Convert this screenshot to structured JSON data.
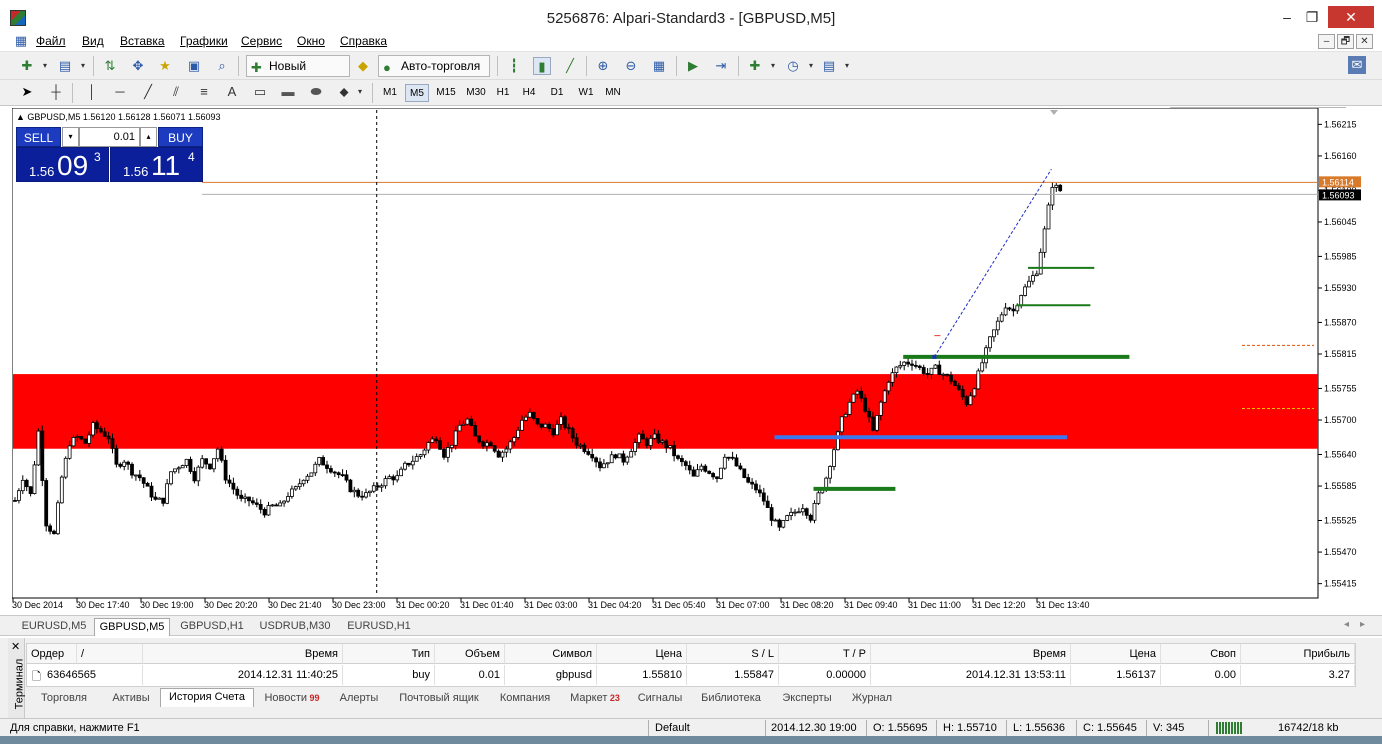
{
  "window": {
    "title": "5256876: Alpari-Standard3 - [GBPUSD,M5]",
    "controls": [
      "–",
      "❐",
      "✕"
    ],
    "mdi_controls": [
      "–",
      "🗗",
      "✕"
    ]
  },
  "menu": [
    "Файл",
    "Вид",
    "Вставка",
    "Графики",
    "Сервис",
    "Окно",
    "Справка"
  ],
  "toolbar": {
    "new_order_label": "Новый Ордер",
    "autotrade_label": "Авто-торговля",
    "text_tool": "A"
  },
  "timeframes": [
    "M1",
    "M5",
    "M15",
    "M30",
    "H1",
    "H4",
    "D1",
    "W1",
    "MN"
  ],
  "active_timeframe": "M5",
  "chart": {
    "info_line": "GBPUSD,M5  1.56120 1.56128 1.56071 1.56093",
    "one_click": {
      "sell_label": "SELL",
      "buy_label": "BUY",
      "lot": "0.01",
      "sell_small": "1.56",
      "sell_big": "09",
      "sell_sup": "3",
      "buy_small": "1.56",
      "buy_big": "11",
      "buy_sup": "4"
    },
    "colors": {
      "zone": "#ff0000",
      "green_level": "#1a7a1a",
      "blue_level": "#3a78ee",
      "ask_line": "#d97a2b",
      "trade_line": "#1f2cc4"
    },
    "ask_marker": "1.56114",
    "bid_marker": "1.56093"
  },
  "chart_data": {
    "type": "candlestick",
    "title": "GBPUSD,M5",
    "ylim": [
      1.5539,
      1.5624
    ],
    "y_ticks": [
      "1.56215",
      "1.56160",
      "1.56100",
      "1.56045",
      "1.55985",
      "1.55930",
      "1.55870",
      "1.55815",
      "1.55755",
      "1.55700",
      "1.55640",
      "1.55585",
      "1.55525",
      "1.55470",
      "1.55415"
    ],
    "x_ticks": [
      "30 Dec 2014",
      "30 Dec 17:40",
      "30 Dec 19:00",
      "30 Dec 20:20",
      "30 Dec 21:40",
      "30 Dec 23:00",
      "31 Dec 00:20",
      "31 Dec 01:40",
      "31 Dec 03:00",
      "31 Dec 04:20",
      "31 Dec 05:40",
      "31 Dec 07:00",
      "31 Dec 08:20",
      "31 Dec 09:40",
      "31 Dec 11:00",
      "31 Dec 12:20",
      "31 Dec 13:40"
    ],
    "close_path": [
      [
        0,
        1.5556
      ],
      [
        2,
        1.556
      ],
      [
        4,
        1.5557
      ],
      [
        6,
        1.5568
      ],
      [
        8,
        1.5552
      ],
      [
        10,
        1.555
      ],
      [
        12,
        1.556
      ],
      [
        14,
        1.5566
      ],
      [
        16,
        1.5567
      ],
      [
        18,
        1.5566
      ],
      [
        20,
        1.5569
      ],
      [
        22,
        1.5568
      ],
      [
        24,
        1.5567
      ],
      [
        26,
        1.5562
      ],
      [
        28,
        1.5563
      ],
      [
        30,
        1.5561
      ],
      [
        32,
        1.556
      ],
      [
        34,
        1.5558
      ],
      [
        36,
        1.5556
      ],
      [
        38,
        1.5556
      ],
      [
        40,
        1.5561
      ],
      [
        42,
        1.5562
      ],
      [
        44,
        1.5563
      ],
      [
        46,
        1.556
      ],
      [
        48,
        1.5563
      ],
      [
        50,
        1.5562
      ],
      [
        52,
        1.5565
      ],
      [
        54,
        1.556
      ],
      [
        56,
        1.5558
      ],
      [
        58,
        1.5556
      ],
      [
        60,
        1.5556
      ],
      [
        62,
        1.5555
      ],
      [
        64,
        1.5554
      ],
      [
        66,
        1.5555
      ],
      [
        68,
        1.5555
      ],
      [
        70,
        1.5557
      ],
      [
        72,
        1.5558
      ],
      [
        74,
        1.556
      ],
      [
        76,
        1.5561
      ],
      [
        78,
        1.5563
      ],
      [
        80,
        1.5562
      ],
      [
        82,
        1.5561
      ],
      [
        84,
        1.556
      ],
      [
        86,
        1.5558
      ],
      [
        88,
        1.5557
      ],
      [
        90,
        1.5557
      ],
      [
        92,
        1.5558
      ],
      [
        94,
        1.5559
      ],
      [
        96,
        1.556
      ],
      [
        98,
        1.556
      ],
      [
        100,
        1.5562
      ],
      [
        102,
        1.5563
      ],
      [
        104,
        1.5564
      ],
      [
        106,
        1.5566
      ],
      [
        108,
        1.5567
      ],
      [
        110,
        1.5564
      ],
      [
        112,
        1.5566
      ],
      [
        114,
        1.5569
      ],
      [
        116,
        1.557
      ],
      [
        118,
        1.5567
      ],
      [
        120,
        1.5566
      ],
      [
        122,
        1.5566
      ],
      [
        124,
        1.5564
      ],
      [
        126,
        1.5565
      ],
      [
        128,
        1.5567
      ],
      [
        130,
        1.557
      ],
      [
        132,
        1.5571
      ],
      [
        134,
        1.5569
      ],
      [
        136,
        1.5569
      ],
      [
        138,
        1.5568
      ],
      [
        140,
        1.557
      ],
      [
        142,
        1.5568
      ],
      [
        144,
        1.5566
      ],
      [
        146,
        1.5565
      ],
      [
        148,
        1.5564
      ],
      [
        150,
        1.5562
      ],
      [
        152,
        1.5563
      ],
      [
        154,
        1.5564
      ],
      [
        156,
        1.5563
      ],
      [
        158,
        1.5565
      ],
      [
        160,
        1.5567
      ],
      [
        162,
        1.5566
      ],
      [
        164,
        1.5567
      ],
      [
        166,
        1.5566
      ],
      [
        168,
        1.5565
      ],
      [
        170,
        1.5563
      ],
      [
        172,
        1.5562
      ],
      [
        174,
        1.556
      ],
      [
        176,
        1.5562
      ],
      [
        178,
        1.5561
      ],
      [
        180,
        1.556
      ],
      [
        182,
        1.5564
      ],
      [
        184,
        1.5563
      ],
      [
        186,
        1.5561
      ],
      [
        188,
        1.5559
      ],
      [
        190,
        1.5558
      ],
      [
        192,
        1.5556
      ],
      [
        194,
        1.5553
      ],
      [
        196,
        1.5551
      ],
      [
        198,
        1.5553
      ],
      [
        200,
        1.5554
      ],
      [
        202,
        1.5555
      ],
      [
        204,
        1.5553
      ],
      [
        206,
        1.5557
      ],
      [
        208,
        1.556
      ],
      [
        210,
        1.5565
      ],
      [
        212,
        1.557
      ],
      [
        214,
        1.5573
      ],
      [
        216,
        1.5575
      ],
      [
        218,
        1.5572
      ],
      [
        220,
        1.5568
      ],
      [
        222,
        1.5573
      ],
      [
        224,
        1.5577
      ],
      [
        226,
        1.5579
      ],
      [
        228,
        1.558
      ],
      [
        230,
        1.558
      ],
      [
        232,
        1.5579
      ],
      [
        234,
        1.5578
      ],
      [
        236,
        1.5579
      ],
      [
        238,
        1.5578
      ],
      [
        240,
        1.5577
      ],
      [
        242,
        1.5575
      ],
      [
        244,
        1.5573
      ],
      [
        246,
        1.5576
      ],
      [
        248,
        1.558
      ],
      [
        250,
        1.5584
      ],
      [
        252,
        1.5587
      ],
      [
        254,
        1.559
      ],
      [
        256,
        1.5589
      ],
      [
        258,
        1.5592
      ],
      [
        260,
        1.5594
      ],
      [
        262,
        1.5596
      ],
      [
        264,
        1.5603
      ],
      [
        266,
        1.5611
      ],
      [
        268,
        1.561
      ]
    ],
    "levels": [
      {
        "name": "resistance-zone",
        "low": 1.5565,
        "high": 1.5578
      },
      {
        "name": "green-level-1",
        "value": 1.55965
      },
      {
        "name": "green-level-2",
        "value": 1.559
      },
      {
        "name": "green-level-3",
        "value": 1.5581
      },
      {
        "name": "blue-level",
        "value": 1.5567
      },
      {
        "name": "green-level-4",
        "value": 1.5558
      },
      {
        "name": "ask-line",
        "value": 1.56114
      },
      {
        "name": "bid-line",
        "value": 1.56093
      }
    ]
  },
  "chart_tabs": [
    "EURUSD,M5",
    "GBPUSD,M5",
    "GBPUSD,H1",
    "USDRUB,M30",
    "EURUSD,H1"
  ],
  "active_chart_tab": "GBPUSD,M5",
  "terminal": {
    "side_label": "Терминал",
    "columns": [
      "Ордер",
      "/",
      "Время",
      "Тип",
      "Объем",
      "Символ",
      "Цена",
      "S / L",
      "T / P",
      "Время",
      "Цена",
      "Своп",
      "Прибыль"
    ],
    "row": {
      "order": "63646565",
      "open_time": "2014.12.31 11:40:25",
      "type": "buy",
      "volume": "0.01",
      "symbol": "gbpusd",
      "open_price": "1.55810",
      "sl": "1.55847",
      "tp": "0.00000",
      "close_time": "2014.12.31 13:53:11",
      "close_price": "1.56137",
      "swap": "0.00",
      "profit": "3.27"
    },
    "tabs": [
      {
        "label": "Торговля",
        "badge": ""
      },
      {
        "label": "Активы",
        "badge": ""
      },
      {
        "label": "История Счета",
        "badge": ""
      },
      {
        "label": "Новости",
        "badge": "99"
      },
      {
        "label": "Алерты",
        "badge": ""
      },
      {
        "label": "Почтовый ящик",
        "badge": ""
      },
      {
        "label": "Компания",
        "badge": ""
      },
      {
        "label": "Маркет",
        "badge": "23"
      },
      {
        "label": "Сигналы",
        "badge": ""
      },
      {
        "label": "Библиотека",
        "badge": ""
      },
      {
        "label": "Эксперты",
        "badge": ""
      },
      {
        "label": "Журнал",
        "badge": ""
      }
    ],
    "active_tab": "История Счета"
  },
  "status": {
    "help": "Для справки, нажмите F1",
    "profile": "Default",
    "datetime": "2014.12.30 19:00",
    "open": "O: 1.55695",
    "high": "H: 1.55710",
    "low": "L: 1.55636",
    "close": "C: 1.55645",
    "volume": "V: 345",
    "traffic": "16742/18 kb"
  }
}
